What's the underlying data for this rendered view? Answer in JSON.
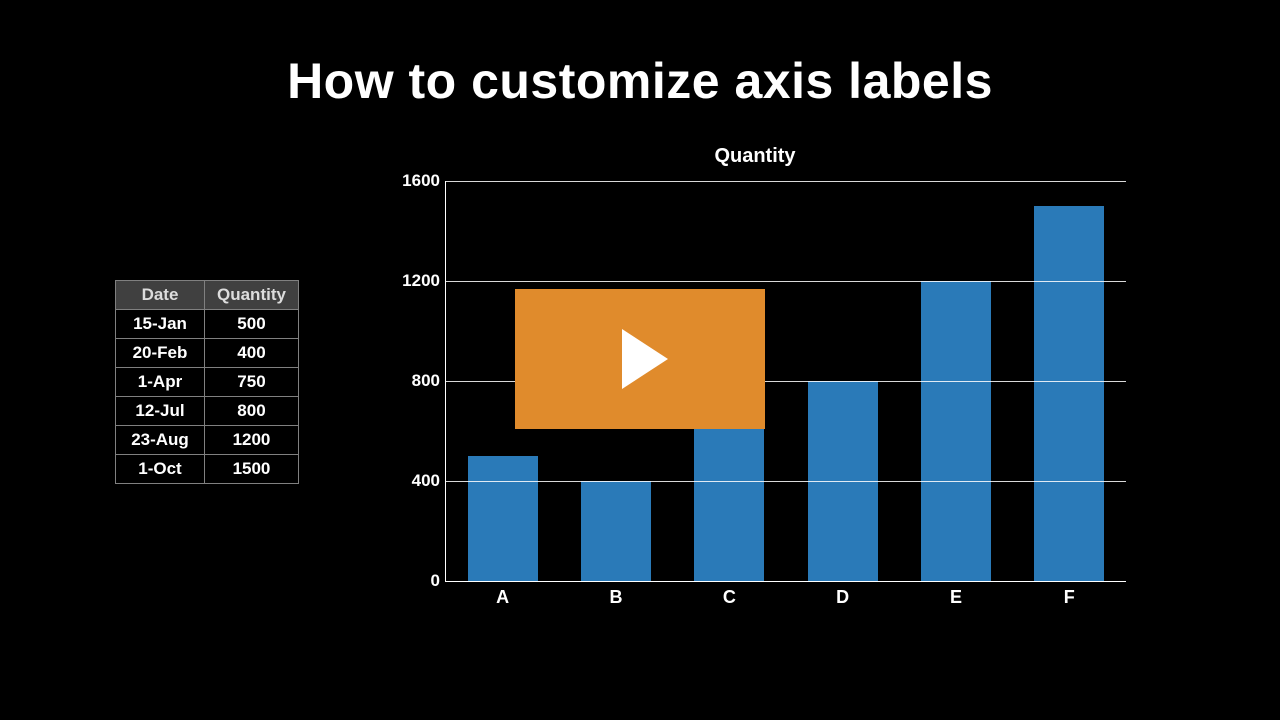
{
  "title": "How to customize axis labels",
  "table": {
    "headers": [
      "Date",
      "Quantity"
    ],
    "rows": [
      [
        "15-Jan",
        "500"
      ],
      [
        "20-Feb",
        "400"
      ],
      [
        "1-Apr",
        "750"
      ],
      [
        "12-Jul",
        "800"
      ],
      [
        "23-Aug",
        "1200"
      ],
      [
        "1-Oct",
        "1500"
      ]
    ]
  },
  "chart_data": {
    "type": "bar",
    "title": "Quantity",
    "xlabel": "",
    "ylabel": "",
    "ylim": [
      0,
      1600
    ],
    "yticks": [
      0,
      400,
      800,
      1200,
      1600
    ],
    "categories": [
      "A",
      "B",
      "C",
      "D",
      "E",
      "F"
    ],
    "values": [
      500,
      400,
      750,
      800,
      1200,
      1500
    ],
    "bar_color": "#2a7ab8"
  },
  "play": {
    "accent": "#e08b2c"
  }
}
